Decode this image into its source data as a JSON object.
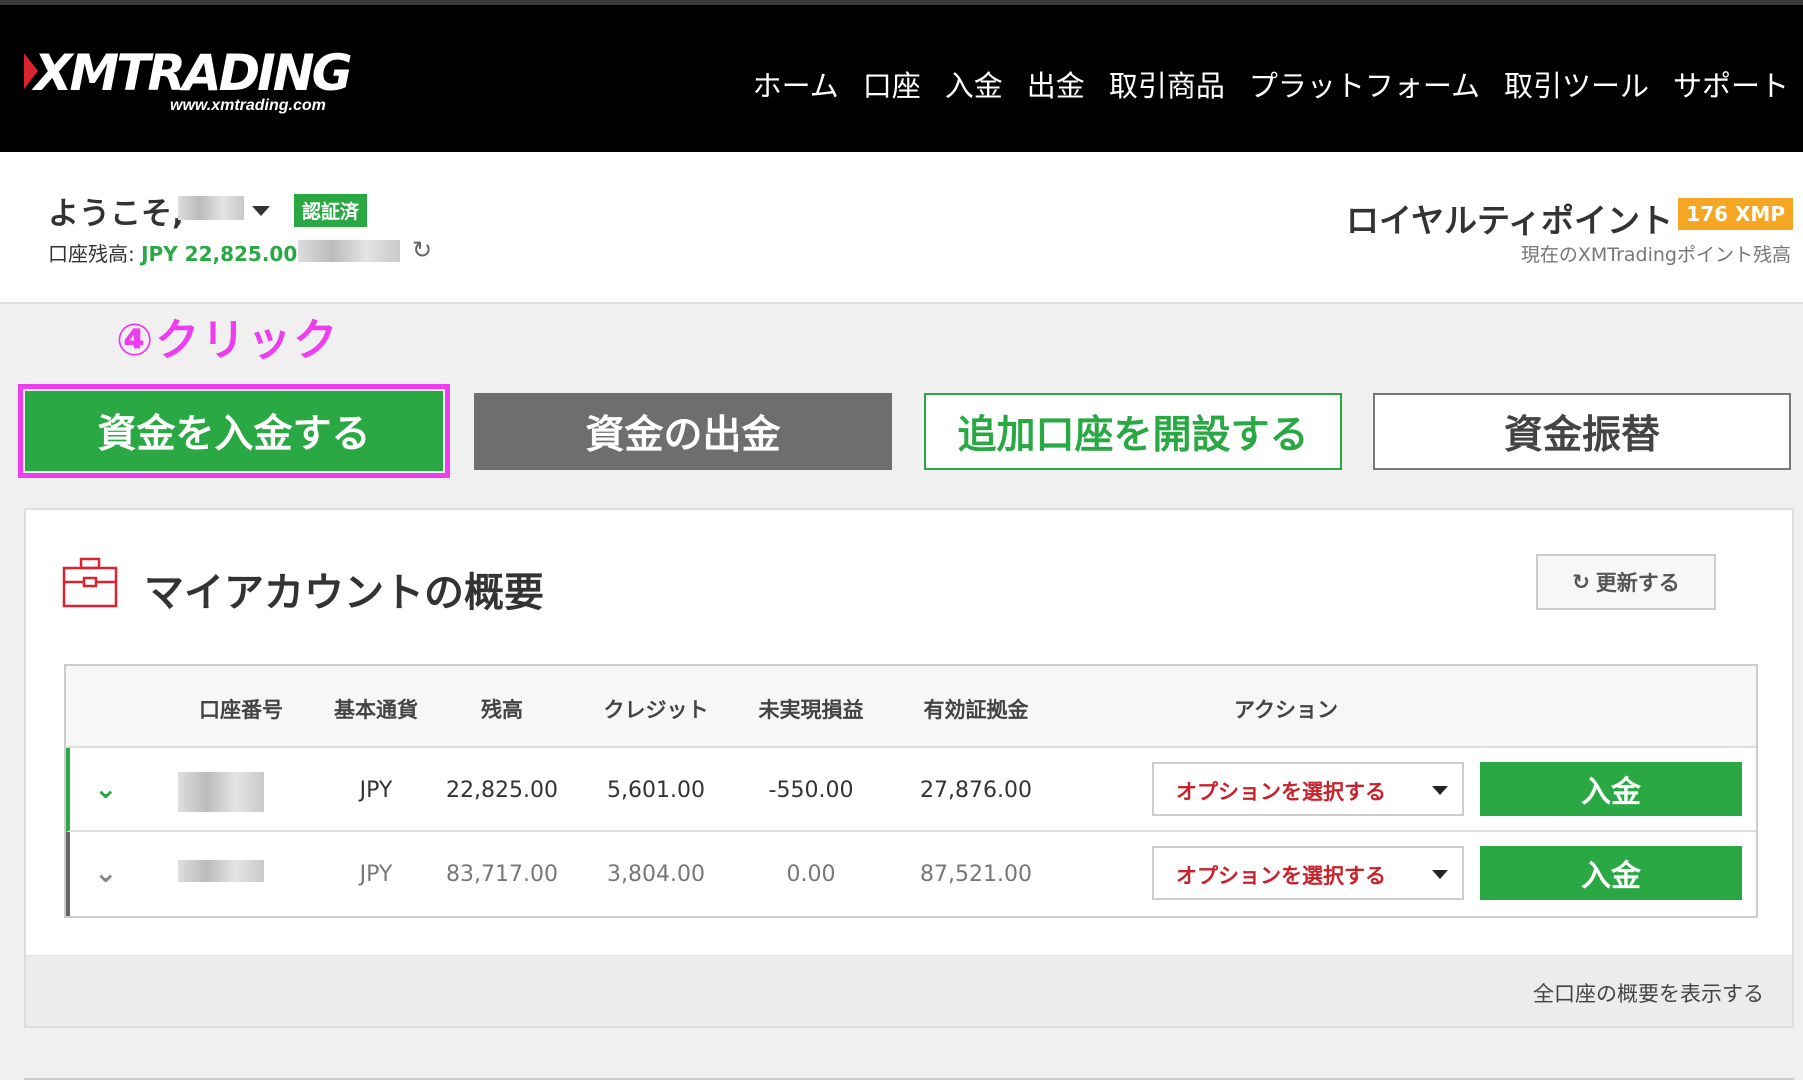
{
  "header": {
    "logo_text": "XMTRADING",
    "logo_url": "www.xmtrading.com",
    "nav": [
      "ホーム",
      "口座",
      "入金",
      "出金",
      "取引商品",
      "プラットフォーム",
      "取引ツール",
      "サポート"
    ]
  },
  "welcome": {
    "greeting": "ようこそ,",
    "verified_badge": "認証済",
    "balance_label": "口座残高: ",
    "balance_value": "JPY 22,825.00",
    "loyalty_title": "ロイヤルティポイント",
    "loyalty_badge": "176 XMP",
    "loyalty_sub": "現在のXMTradingポイント残高"
  },
  "annotation": "④クリック",
  "actions": {
    "deposit": "資金を入金する",
    "withdraw": "資金の出金",
    "open_account": "追加口座を開設する",
    "transfer": "資金振替"
  },
  "overview": {
    "title": "マイアカウントの概要",
    "update_button": "更新する",
    "columns": [
      "口座番号",
      "基本通貨",
      "残高",
      "クレジット",
      "未実現損益",
      "有効証拠金",
      "アクション"
    ],
    "rows": [
      {
        "currency": "JPY",
        "balance": "22,825.00",
        "credit": "5,601.00",
        "pnl": "-550.00",
        "equity": "27,876.00",
        "select_label": "オプションを選択する",
        "deposit_label": "入金"
      },
      {
        "currency": "JPY",
        "balance": "83,717.00",
        "credit": "3,804.00",
        "pnl": "0.00",
        "equity": "87,521.00",
        "select_label": "オプションを選択する",
        "deposit_label": "入金"
      }
    ],
    "show_all": "全口座の概要を表示する"
  },
  "colors": {
    "green": "#2aa844",
    "highlight": "#ee3df0",
    "badge_orange": "#f5a623",
    "select_red": "#c8222c"
  }
}
